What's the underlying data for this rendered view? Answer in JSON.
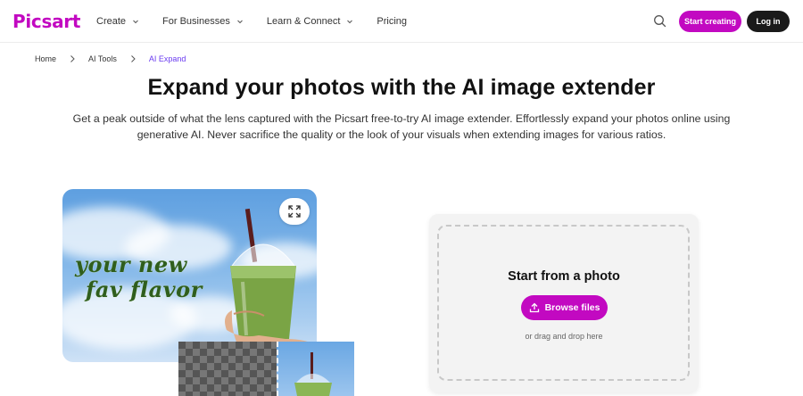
{
  "brand": {
    "logo_text": "Picsart",
    "accent": "#c209c1"
  },
  "nav": {
    "items": [
      {
        "label": "Create",
        "has_dropdown": true
      },
      {
        "label": "For Businesses",
        "has_dropdown": true
      },
      {
        "label": "Learn & Connect",
        "has_dropdown": true
      },
      {
        "label": "Pricing",
        "has_dropdown": false
      }
    ],
    "search_icon": "search-icon",
    "start_creating_label": "Start creating",
    "login_label": "Log in"
  },
  "breadcrumb": {
    "items": [
      "Home",
      "AI Tools",
      "AI Expand"
    ],
    "current_color": "#6b3cf0"
  },
  "hero": {
    "title": "Expand your photos with the AI image extender",
    "subtitle": "Get a peak outside of what the lens captured with the Picsart free-to-try AI image extender. Effortlessly expand your photos online using generative AI. Never sacrifice the quality or the look of your visuals when extending images for various ratios."
  },
  "showcase": {
    "slogan_line1": "your new",
    "slogan_line2": "fav flavor",
    "expand_icon": "expand-arrows-icon"
  },
  "upload": {
    "title": "Start from a photo",
    "browse_label": "Browse files",
    "browse_icon": "upload-icon",
    "drag_text": "or drag and drop here"
  }
}
